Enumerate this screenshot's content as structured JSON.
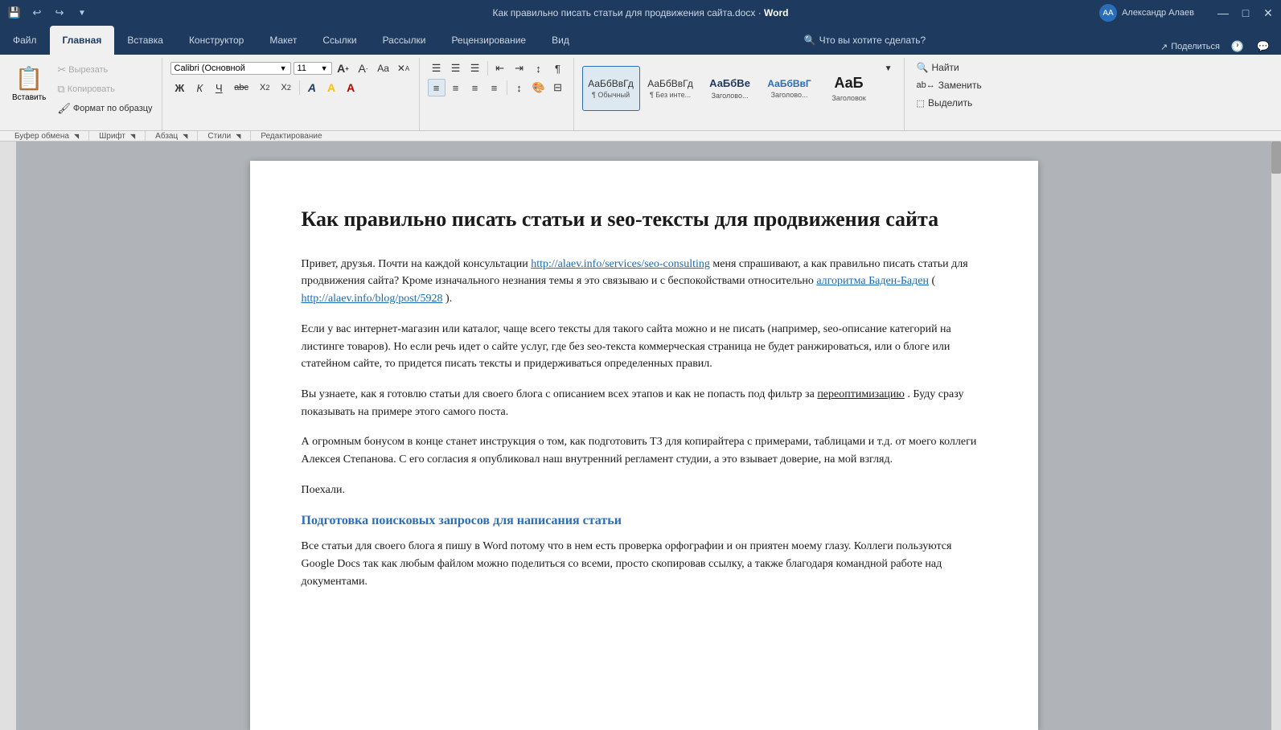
{
  "titlebar": {
    "filename": "Как правильно писать статьи для продвижения сайта.docx",
    "separator": "·",
    "app": "Word",
    "user": "Александр Алаев"
  },
  "tabs": [
    {
      "id": "file",
      "label": "Файл",
      "active": false
    },
    {
      "id": "home",
      "label": "Главная",
      "active": true
    },
    {
      "id": "insert",
      "label": "Вставка",
      "active": false
    },
    {
      "id": "design",
      "label": "Конструктор",
      "active": false
    },
    {
      "id": "layout",
      "label": "Макет",
      "active": false
    },
    {
      "id": "references",
      "label": "Ссылки",
      "active": false
    },
    {
      "id": "mailings",
      "label": "Рассылки",
      "active": false
    },
    {
      "id": "review",
      "label": "Рецензирование",
      "active": false
    },
    {
      "id": "view",
      "label": "Вид",
      "active": false
    },
    {
      "id": "search",
      "label": "🔍 Что вы хотите сделать?",
      "active": false
    }
  ],
  "ribbon": {
    "clipboard": {
      "paste_label": "Вставить",
      "cut_label": "Вырезать",
      "copy_label": "Копировать",
      "format_label": "Формат по образцу",
      "group_label": "Буфер обмена"
    },
    "font": {
      "font_name": "Calibri (Основной",
      "font_size": "11",
      "group_label": "Шрифт",
      "bold": "Ж",
      "italic": "К",
      "underline": "Ч",
      "strikethrough": "abc",
      "subscript": "X₂",
      "superscript": "X²"
    },
    "paragraph": {
      "group_label": "Абзац"
    },
    "styles": {
      "group_label": "Стили",
      "items": [
        {
          "label": "АаБбВвГд",
          "sublabel": "¶ Обычный",
          "active": true
        },
        {
          "label": "АаБбВвГд",
          "sublabel": "¶ Без инте...",
          "active": false
        },
        {
          "label": "АаБбВе",
          "sublabel": "Заголово...",
          "active": false
        },
        {
          "label": "АаБбВвГ",
          "sublabel": "Заголово...",
          "active": false
        },
        {
          "label": "АаБ",
          "sublabel": "Заголовок",
          "active": false
        }
      ]
    },
    "editing": {
      "group_label": "Редактирование",
      "find": "🔍 Найти",
      "replace": "Заменить",
      "select": "Выделить"
    }
  },
  "document": {
    "title": "Как правильно писать статьи и seo-тексты для продвижения сайта",
    "paragraphs": [
      {
        "id": "p1",
        "parts": [
          {
            "text": "Привет, друзья. Почти на каждой консультации "
          },
          {
            "text": "http://alaev.info/services/seo-consulting",
            "link": true
          },
          {
            "text": " меня спрашивают, а как правильно писать статьи для продвижения сайта? Кроме изначального незнания темы я это связываю и с беспокойствами относительно "
          },
          {
            "text": "алгоритма Баден-Баден",
            "link": true
          },
          {
            "text": " ("
          },
          {
            "text": "http://alaev.info/blog/post/5928",
            "link": true
          },
          {
            "text": ")."
          }
        ]
      },
      {
        "id": "p2",
        "text": "Если у вас интернет-магазин или каталог, чаще всего тексты для такого сайта можно и не писать (например, seo-описание категорий на листинге товаров). Но если речь идет о сайте услуг, где без seo-текста коммерческая страница не будет ранжироваться, или о блоге или статейном сайте, то придется писать тексты и придерживаться определенных правил."
      },
      {
        "id": "p3",
        "parts": [
          {
            "text": "Вы узнаете, как я готовлю статьи для своего блога с описанием всех этапов и как не попасть под фильтр за "
          },
          {
            "text": "переоптимизацию",
            "underline": true
          },
          {
            "text": ". Буду сразу показывать на примере этого самого поста."
          }
        ]
      },
      {
        "id": "p4",
        "text": "А огромным бонусом в конце станет инструкция о том, как подготовить ТЗ для копирайтера с примерами, таблицами и т.д. от моего коллеги Алексея Степанова. С его согласия я опубликовал наш внутренний регламент студии, а это взывает доверие, на мой взгляд."
      },
      {
        "id": "p5",
        "text": "Поехали."
      }
    ],
    "heading2": "Подготовка поисковых запросов для написания статьи",
    "last_para": "Все статьи для своего блога я пишу в Word потому что в нем есть проверка орфографии и он приятен моему глазу. Коллеги пользуются Google Docs так как любым файлом можно поделиться со всеми, просто скопировав ссылку, а также благодаря командной работе над документами."
  },
  "icons": {
    "undo": "↩",
    "redo": "↪",
    "save": "💾",
    "clipboard": "📋",
    "scissors": "✂",
    "copy": "⧉",
    "brush": "🖌",
    "bold": "B",
    "italic": "I",
    "underline": "U",
    "strikethrough": "S",
    "font_color": "A",
    "highlight": "A",
    "bullets": "☰",
    "numbered": "☰",
    "decrease_indent": "⇤",
    "increase_indent": "⇥",
    "sort": "↕",
    "show_para": "¶",
    "align_left": "≡",
    "align_center": "≡",
    "align_right": "≡",
    "justify": "≡",
    "line_spacing": "↕",
    "shading": "🎨",
    "border": "⊟",
    "find": "🔍",
    "chevron_down": "▼",
    "share": "↗",
    "history": "🕐",
    "comment": "💬",
    "expand": "◥",
    "minimize": "—",
    "maximize": "□",
    "close": "✕",
    "grow": "A+",
    "shrink": "A-",
    "case": "Aa",
    "clear": "✕"
  }
}
